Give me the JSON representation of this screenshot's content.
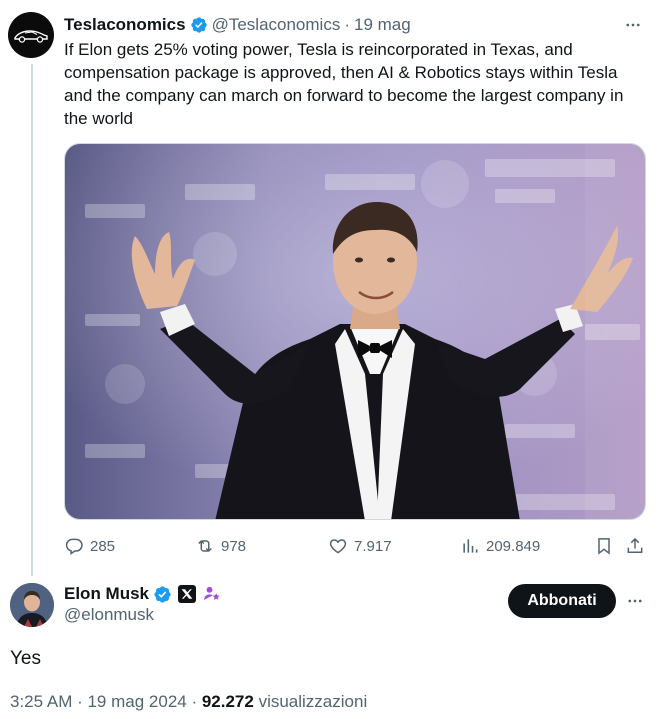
{
  "parent_tweet": {
    "author_name": "Teslaconomics",
    "handle": "@Teslaconomics",
    "separator": "·",
    "time": "19 mag",
    "text": "If Elon gets 25% voting power, Tesla is reincorporated in Texas, and compensation package is approved, then AI & Robotics stays within Tesla and the company can march on forward to become the largest company in the world",
    "avatar_icon": "tesla-car-logo-icon",
    "media_alt_icon": "photo-man-tuxedo-arms-raised",
    "stats": {
      "replies": "285",
      "reposts": "978",
      "likes": "7.917",
      "views": "209.849"
    }
  },
  "reply_tweet": {
    "author_name": "Elon Musk",
    "handle": "@elonmusk",
    "follow_label": "Abbonati",
    "text": "Yes",
    "timestamp": "3:25 AM · 19 mag 2024 · ",
    "views_count": "92.272",
    "views_label": " visualizzazioni"
  },
  "colors": {
    "verified_blue": "#1d9bf0",
    "text_primary": "#0f1419",
    "text_secondary": "#536471",
    "border": "#cfd9de",
    "badge_purple": "#a34bd8"
  }
}
